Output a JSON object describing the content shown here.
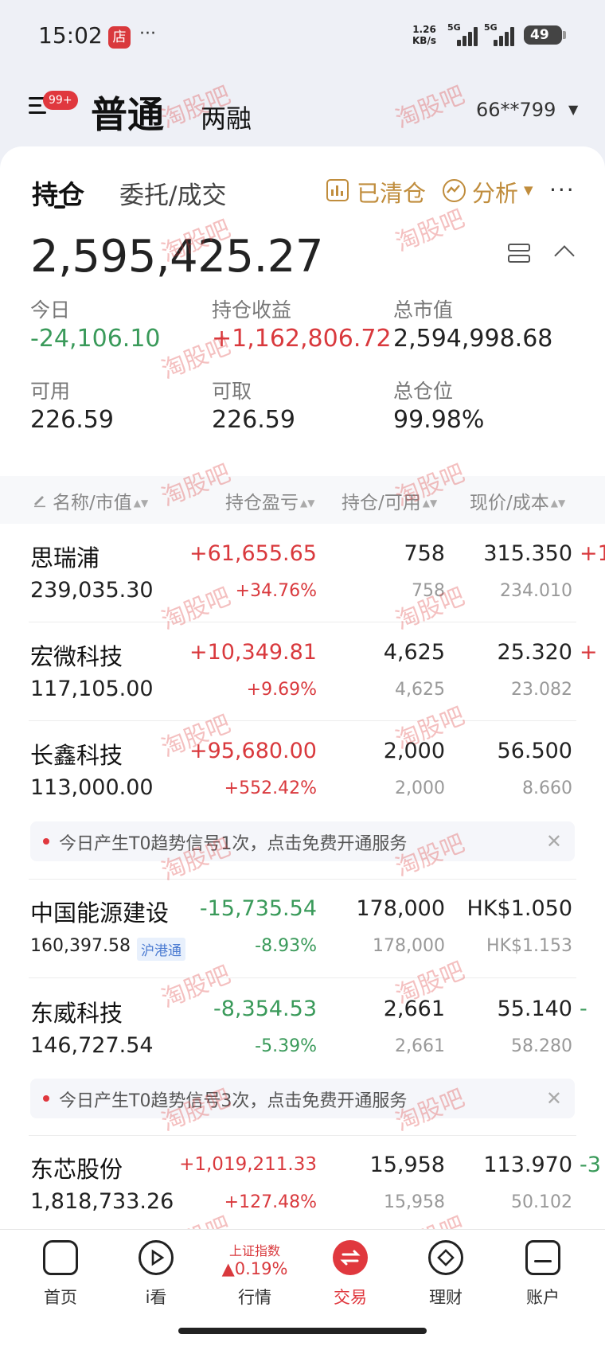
{
  "status_bar": {
    "time": "15:02",
    "store_badge": "店",
    "more": "···",
    "net_speed_value": "1.26",
    "net_speed_unit": "KB/s",
    "signal1_label": "5G",
    "signal2_label": "5G",
    "battery": "49"
  },
  "header": {
    "menu_badge": "99+",
    "tab_normal": "普通",
    "tab_margin": "两融",
    "account": "66**799",
    "caret": "▼"
  },
  "tabs": {
    "positions": "持仓",
    "orders": "委托/成交",
    "cleared": "已清仓",
    "analysis": "分析",
    "more": "···"
  },
  "summary": {
    "total_assets": "2,595,425.27",
    "today_label": "今日",
    "today_value": "-24,106.10",
    "position_pl_label": "持仓收益",
    "position_pl_value": "+1,162,806.72",
    "market_value_label": "总市值",
    "market_value_value": "2,594,998.68",
    "available_label": "可用",
    "available_value": "226.59",
    "withdrawable_label": "可取",
    "withdrawable_value": "226.59",
    "total_position_label": "总仓位",
    "total_position_value": "99.98%"
  },
  "table": {
    "col_name": "名称/市值",
    "col_pl": "持仓盈亏",
    "col_qty": "持仓/可用",
    "col_price": "现价/成本",
    "rows": [
      {
        "name": "思瑞浦",
        "market_value": "239,035.30",
        "pl": "+61,655.65",
        "pl_pct": "+34.76%",
        "qty": "758",
        "available": "758",
        "price": "315.350",
        "cost": "234.010",
        "cut": "+1"
      },
      {
        "name": "宏微科技",
        "market_value": "117,105.00",
        "pl": "+10,349.81",
        "pl_pct": "+9.69%",
        "qty": "4,625",
        "available": "4,625",
        "price": "25.320",
        "cost": "23.082",
        "cut": "+"
      },
      {
        "name": "长鑫科技",
        "market_value": "113,000.00",
        "pl": "+95,680.00",
        "pl_pct": "+552.42%",
        "qty": "2,000",
        "available": "2,000",
        "price": "56.500",
        "cost": "8.660",
        "cut": ""
      },
      {
        "name": "中国能源建设",
        "market_value": "160,397.58",
        "tag": "沪港通",
        "pl": "-15,735.54",
        "pl_pct": "-8.93%",
        "qty": "178,000",
        "available": "178,000",
        "price": "HK$1.050",
        "cost": "HK$1.153",
        "cut": ""
      },
      {
        "name": "东威科技",
        "market_value": "146,727.54",
        "pl": "-8,354.53",
        "pl_pct": "-5.39%",
        "qty": "2,661",
        "available": "2,661",
        "price": "55.140",
        "cost": "58.280",
        "cut": "-"
      },
      {
        "name": "东芯股份",
        "market_value": "1,818,733.26",
        "pl": "+1,019,211.33",
        "pl_pct": "+127.48%",
        "qty": "15,958",
        "available": "15,958",
        "price": "113.970",
        "cost": "50.102",
        "cut": "-3"
      }
    ],
    "signal_1": "今日产生T0趋势信号1次，点击免费开通服务",
    "signal_2": "今日产生T0趋势信号3次，点击免费开通服务",
    "close": "✕"
  },
  "bottom_nav": {
    "home": "首页",
    "watch": "i看",
    "index_name": "上证指数",
    "index_value": "▲0.19%",
    "market": "行情",
    "trade": "交易",
    "wealth": "理财",
    "account": "账户"
  },
  "watermark": "淘股吧",
  "colors": {
    "gain": "#d9393d",
    "loss": "#3a9a5a",
    "accent": "#c08d3d",
    "trade_active": "#e0383e"
  }
}
